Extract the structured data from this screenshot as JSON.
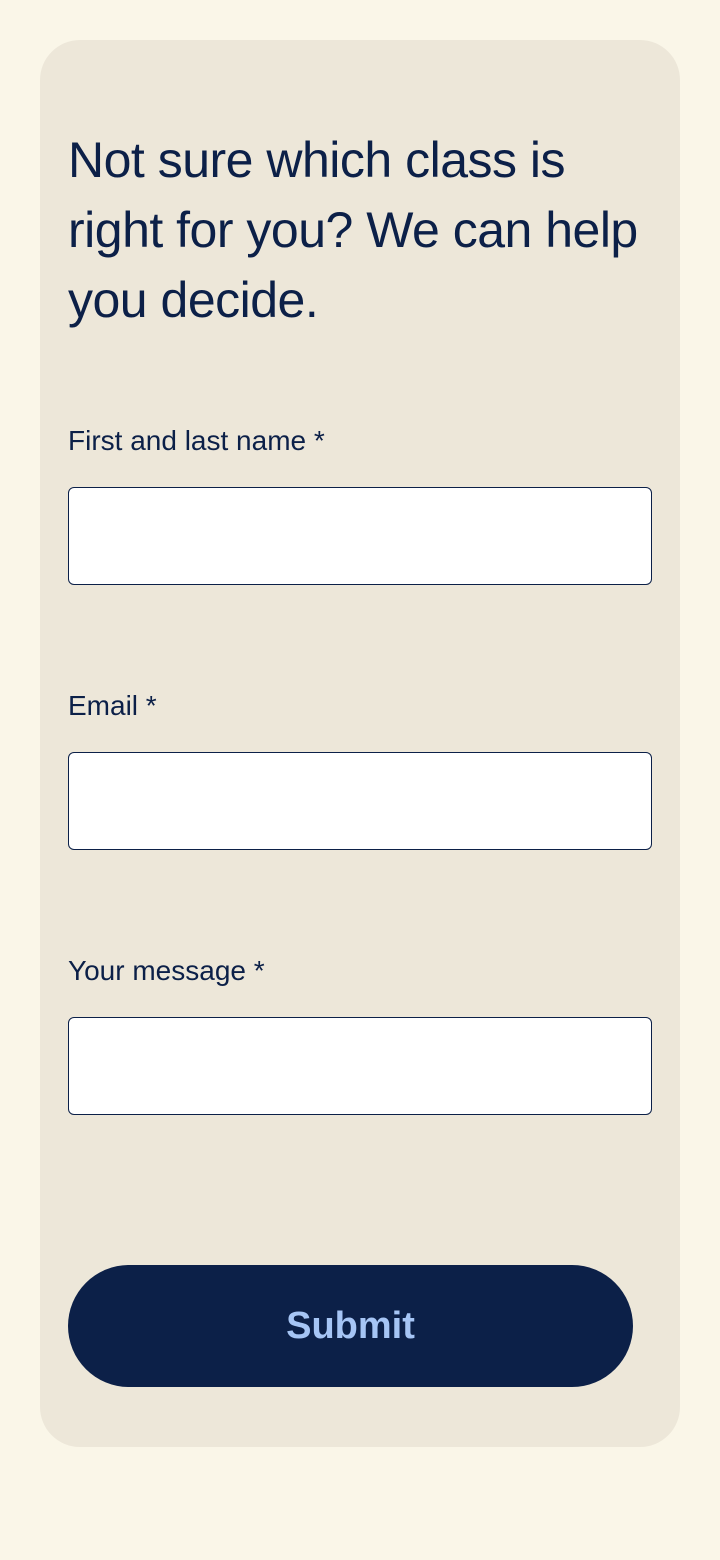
{
  "form": {
    "heading": "Not sure which class is right for you? We can help you decide.",
    "fields": {
      "name": {
        "label": "First and last name *",
        "value": ""
      },
      "email": {
        "label": "Email *",
        "value": ""
      },
      "message": {
        "label": "Your message *",
        "value": ""
      }
    },
    "submit_label": "Submit"
  }
}
